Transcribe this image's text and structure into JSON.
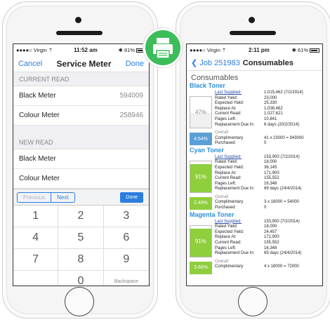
{
  "left": {
    "status": {
      "carrier": "●●●●○ Virgin ⇡",
      "time": "11:52 am",
      "battery": "✱ 81%"
    },
    "nav": {
      "cancel": "Cancel",
      "title": "Service Meter",
      "done": "Done"
    },
    "current_read": {
      "header": "CURRENT READ",
      "rows": [
        {
          "label": "Black Meter",
          "value": "594009"
        },
        {
          "label": "Colour Meter",
          "value": "258946"
        }
      ]
    },
    "new_read": {
      "header": "NEW READ",
      "rows": [
        {
          "label": "Black Meter"
        },
        {
          "label": "Colour Meter"
        }
      ]
    },
    "toolbar": {
      "previous": "Previous",
      "next": "Next",
      "done": "Done"
    },
    "keypad": [
      "1",
      "2",
      "3",
      "4",
      "5",
      "6",
      "7",
      "8",
      "9",
      "",
      "0",
      "Backspace"
    ]
  },
  "right": {
    "status": {
      "carrier": "●●●●○ Virgin ⇡",
      "time": "2:11 pm",
      "battery": "✱ 61%"
    },
    "nav": {
      "back": "❮ Job 251983",
      "title": "Consumables"
    },
    "heading": "Consumables",
    "toners": [
      {
        "name": "Black Toner",
        "gauge_label": "47%",
        "fill": 0.47,
        "fill_color": "#f0f0f0",
        "label_color": "#888888",
        "rows": [
          {
            "k": "Last Supplied:",
            "v": "1,015,462 (7/2/2014)",
            "link": true
          },
          {
            "k": "Rated Yield:",
            "v": "23,000"
          },
          {
            "k": "Expected Yield:",
            "v": "25,330"
          },
          {
            "k": "Replace At:",
            "v": "1,038,462"
          },
          {
            "k": "Current Read:",
            "v": "1,027,621"
          },
          {
            "k": "Pages Left:",
            "v": "10,841"
          },
          {
            "k": "Replacement Due In:",
            "v": "6 days (20/2/2014)"
          }
        ],
        "badge": "4.54%",
        "badge_color": "#5a9fd6",
        "comp": [
          {
            "k": "Overall",
            "v": "",
            "grey": true
          },
          {
            "k": "Complimentary",
            "v": "41 x 23000 = 943000"
          },
          {
            "k": "Purchased",
            "v": "0"
          }
        ]
      },
      {
        "name": "Cyan Toner",
        "gauge_label": "91%",
        "fill": 0.91,
        "fill_color": "#8fce3d",
        "label_color": "#ffffff",
        "rows": [
          {
            "k": "Last Supplied:",
            "v": "153,900 (7/2/2014)",
            "link": true
          },
          {
            "k": "Rated Yield:",
            "v": "18,000"
          },
          {
            "k": "Expected Yield:",
            "v": "36,145"
          },
          {
            "k": "Replace At:",
            "v": "171,900"
          },
          {
            "k": "Current Read:",
            "v": "155,552"
          },
          {
            "k": "Pages Left:",
            "v": "16,348"
          },
          {
            "k": "Replacement Due In:",
            "v": "69 days (24/4/2014)"
          }
        ],
        "badge": "2.49%",
        "badge_color": "#8fce3d",
        "comp": [
          {
            "k": "Overall",
            "v": "",
            "grey": true
          },
          {
            "k": "Complimentary",
            "v": "3 x 18000 = 54000"
          },
          {
            "k": "Purchased",
            "v": "0"
          }
        ]
      },
      {
        "name": "Magenta Toner",
        "gauge_label": "91%",
        "fill": 0.91,
        "fill_color": "#8fce3d",
        "label_color": "#ffffff",
        "rows": [
          {
            "k": "Last Supplied:",
            "v": "153,900 (7/2/2014)",
            "link": true
          },
          {
            "k": "Rated Yield:",
            "v": "18,000"
          },
          {
            "k": "Expected Yield:",
            "v": "24,457"
          },
          {
            "k": "Replace At:",
            "v": "171,900"
          },
          {
            "k": "Current Read:",
            "v": "155,552"
          },
          {
            "k": "Pages Left:",
            "v": "16,348"
          },
          {
            "k": "Replacement Due In:",
            "v": "69 days (24/4/2014)"
          }
        ],
        "badge": "3.66%",
        "badge_color": "#8fce3d",
        "comp": [
          {
            "k": "Overall",
            "v": "",
            "grey": true
          },
          {
            "k": "Complimentary",
            "v": "4 x 18000 = 72000"
          }
        ]
      }
    ]
  },
  "colors": {
    "accent": "#2a7ee0",
    "toner_heading": "#2a8fd6",
    "printer_badge": "#3dbd5a"
  },
  "icons": [
    "printer-icon",
    "wifi-icon",
    "bluetooth-icon",
    "battery-icon",
    "back-chevron-icon"
  ]
}
